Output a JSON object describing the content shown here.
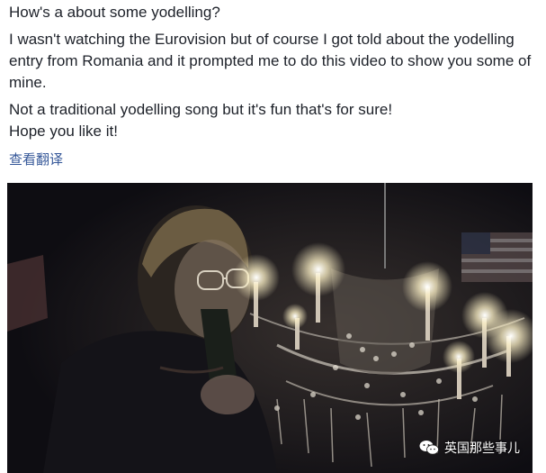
{
  "post": {
    "lines": [
      "How's a about some yodelling?",
      "I wasn't watching the Eurovision but of course I got told about the yodelling entry from Romania and it prompted me to do this video to show you some of mine.",
      "Not a traditional yodelling song but it's fun that's for sure!",
      "Hope you like it!"
    ],
    "translate_link": "查看翻译"
  },
  "video": {
    "watermark_text": "英国那些事儿",
    "watermark_icon": "wechat-icon",
    "scene": "person-with-chandelier"
  },
  "colors": {
    "text": "#1d2129",
    "link": "#365899",
    "video_bg": "#0e0d12"
  }
}
